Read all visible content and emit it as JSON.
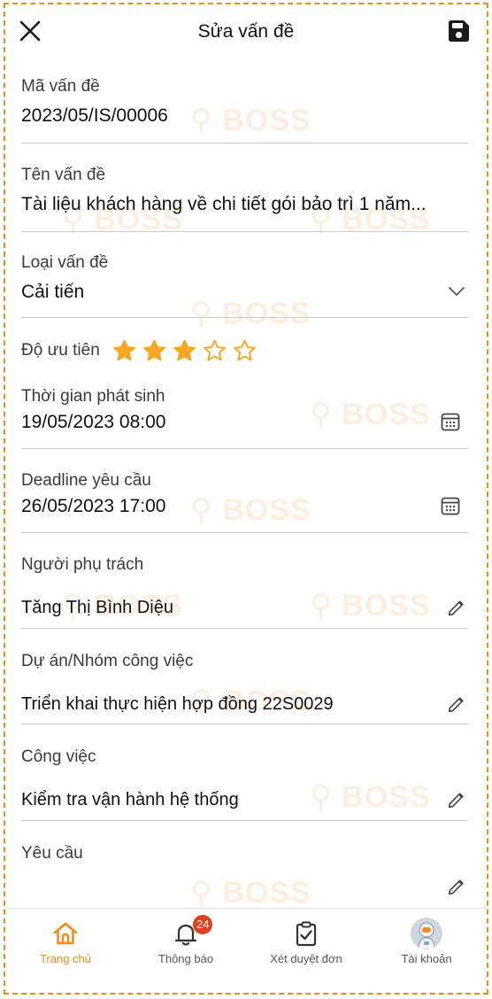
{
  "header": {
    "title": "Sửa vấn đề",
    "close_icon": "close-icon",
    "save_icon": "save-icon"
  },
  "watermark_text": "BOSS",
  "form": {
    "code": {
      "label": "Mã vấn đề",
      "value": "2023/05/IS/00006"
    },
    "name": {
      "label": "Tên vấn đề",
      "value": "Tài liệu khách hàng về chi tiết gói bảo trì 1 năm..."
    },
    "type": {
      "label": "Loại vấn đề",
      "value": "Cải tiến"
    },
    "priority": {
      "label": "Độ ưu tiên",
      "rating": 3,
      "max": 5
    },
    "occurred_time": {
      "label": "Thời gian phát sinh",
      "value": "19/05/2023 08:00"
    },
    "deadline": {
      "label": "Deadline yêu cầu",
      "value": "26/05/2023 17:00"
    },
    "assignee": {
      "label": "Người phụ trách",
      "value": "Tăng Thị Bình Diệu"
    },
    "project": {
      "label": "Dự án/Nhóm công việc",
      "value": "Triển khai thực hiện hợp đồng 22S0029"
    },
    "task": {
      "label": "Công việc",
      "value": "Kiểm tra vận hành hệ thống"
    },
    "request": {
      "label": "Yêu cầu",
      "value": ""
    }
  },
  "nav": {
    "home": "Trang chủ",
    "notifications": "Thông báo",
    "notification_count": "24",
    "approvals": "Xét duyệt đơn",
    "account": "Tài khoản"
  },
  "colors": {
    "accent": "#f08a1c",
    "star": "#f5a623",
    "badge": "#e0401e"
  }
}
